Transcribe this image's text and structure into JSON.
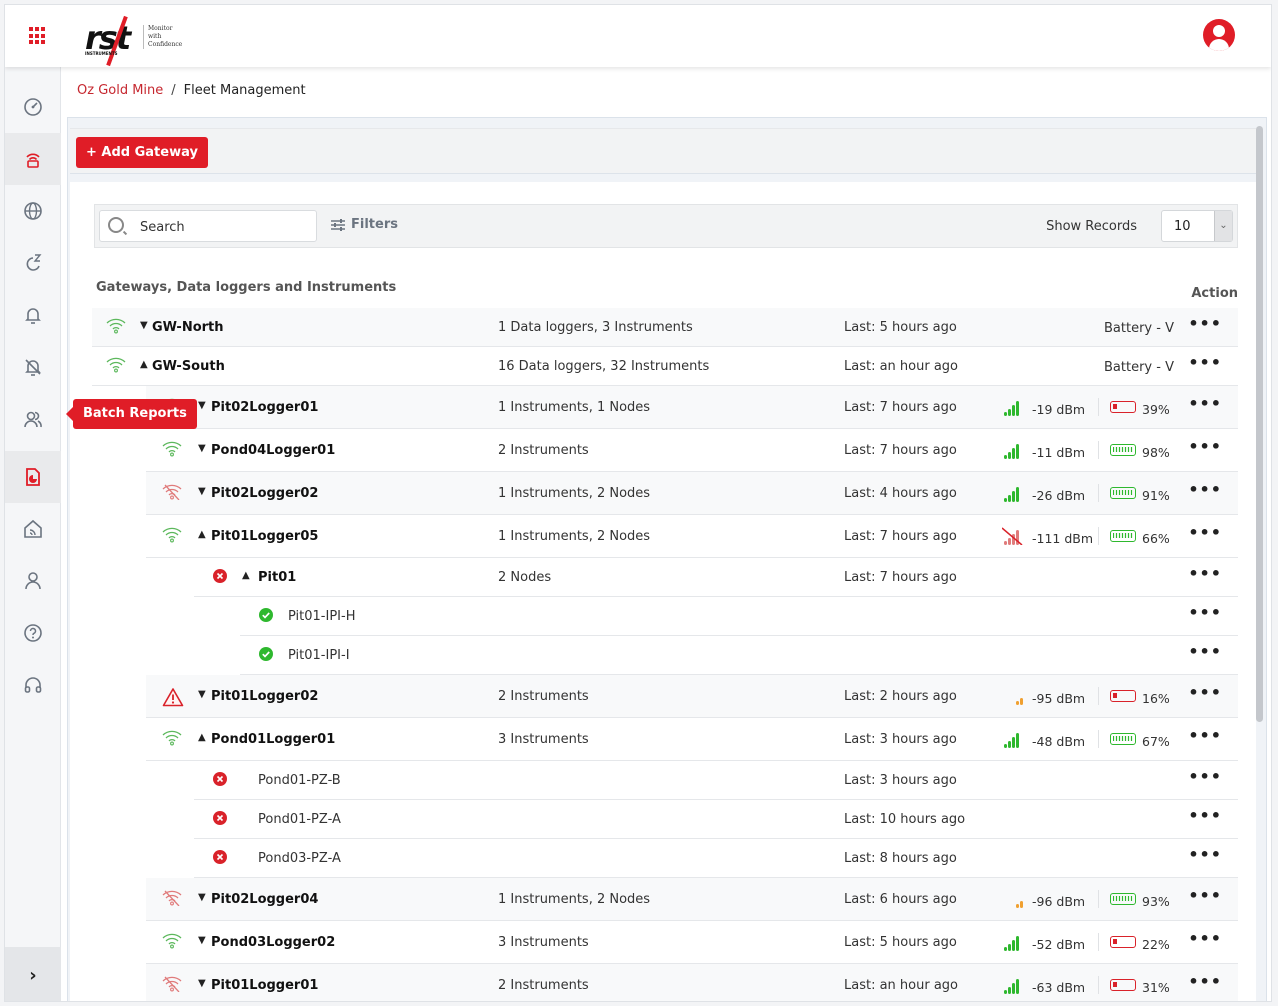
{
  "header": {
    "logo_text": "rst",
    "logo_subtext": "INSTRUMENTS",
    "logo_tagline": "Monitor with Confidence",
    "apps_icon": "grid-apps-icon",
    "user_icon": "user-avatar-icon"
  },
  "sidebar": {
    "items": [
      {
        "icon": "dashboard-gauge-icon",
        "label": "Dashboard",
        "active": false
      },
      {
        "icon": "gateway-router-icon",
        "label": "Fleet Management",
        "active": true
      },
      {
        "icon": "globe-icon",
        "label": "Map",
        "active": false
      },
      {
        "icon": "sleep-icon",
        "label": "Sleep",
        "active": false
      },
      {
        "icon": "bell-icon",
        "label": "Alarms",
        "active": false
      },
      {
        "icon": "bell-off-icon",
        "label": "Muted Alarms",
        "active": false
      },
      {
        "icon": "users-icon",
        "label": "Users",
        "active": false
      },
      {
        "icon": "report-icon",
        "label": "Batch Reports",
        "active": true
      },
      {
        "icon": "home-signal-icon",
        "label": "Sites",
        "active": false
      },
      {
        "icon": "user-icon",
        "label": "Profile",
        "active": false
      },
      {
        "icon": "help-icon",
        "label": "Help",
        "active": false
      },
      {
        "icon": "headset-icon",
        "label": "Support",
        "active": false
      }
    ],
    "tooltip": "Batch Reports",
    "expand_icon": "chevron-right-icon"
  },
  "breadcrumb": {
    "parent": "Oz Gold Mine",
    "separator": "/",
    "current": "Fleet Management"
  },
  "toolbar": {
    "add_gateway_label": "+ Add Gateway"
  },
  "search": {
    "placeholder": "Search",
    "value": "",
    "filters_label": "Filters",
    "show_records_label": "Show Records",
    "records_value": "10"
  },
  "table": {
    "title": "Gateways, Data loggers and Instruments",
    "action_header": "Action",
    "rows": [
      {
        "level": 0,
        "status": "wifi-ok",
        "expand": "down",
        "name": "GW-North",
        "summary": "1 Data loggers, 3 Instruments",
        "last": "Last: 5 hours ago",
        "battery_text": "Battery - V"
      },
      {
        "level": 0,
        "status": "wifi-ok",
        "expand": "up",
        "name": "GW-South",
        "summary": "16 Data loggers, 32 Instruments",
        "last": "Last: an hour ago",
        "battery_text": "Battery - V"
      },
      {
        "level": 1,
        "status": "wifi-ok",
        "expand": "down",
        "name": "Pit02Logger01",
        "summary": "1 Instruments, 1 Nodes",
        "last": "Last: 7 hours ago",
        "signal": "-19 dBm",
        "signal_level": "full",
        "battery_pct": "39%",
        "battery_state": "low"
      },
      {
        "level": 1,
        "status": "wifi-ok",
        "expand": "down",
        "name": "Pond04Logger01",
        "summary": "2 Instruments",
        "last": "Last: 7 hours ago",
        "signal": "-11 dBm",
        "signal_level": "full",
        "battery_pct": "98%",
        "battery_state": "good"
      },
      {
        "level": 1,
        "status": "wifi-off",
        "expand": "down",
        "name": "Pit02Logger02",
        "summary": "1 Instruments, 2 Nodes",
        "last": "Last: 4 hours ago",
        "signal": "-26 dBm",
        "signal_level": "full",
        "battery_pct": "91%",
        "battery_state": "good"
      },
      {
        "level": 1,
        "status": "wifi-ok",
        "expand": "up",
        "name": "Pit01Logger05",
        "summary": "1 Instruments, 2 Nodes",
        "last": "Last: 7 hours ago",
        "signal": "-111 dBm",
        "signal_level": "none",
        "battery_pct": "66%",
        "battery_state": "good"
      },
      {
        "level": 2,
        "status": "error",
        "expand": "up",
        "name": "Pit01",
        "summary": "2 Nodes",
        "last": "Last: 7 hours ago"
      },
      {
        "level": 3,
        "status": "ok",
        "name": "Pit01-IPI-H"
      },
      {
        "level": 3,
        "status": "ok",
        "name": "Pit01-IPI-I"
      },
      {
        "level": 1,
        "status": "warning",
        "expand": "down",
        "name": "Pit01Logger02",
        "summary": "2 Instruments",
        "last": "Last: 2 hours ago",
        "signal": "-95 dBm",
        "signal_level": "weak",
        "battery_pct": "16%",
        "battery_state": "low"
      },
      {
        "level": 1,
        "status": "wifi-ok",
        "expand": "up",
        "name": "Pond01Logger01",
        "summary": "3 Instruments",
        "last": "Last: 3 hours ago",
        "signal": "-48 dBm",
        "signal_level": "full",
        "battery_pct": "67%",
        "battery_state": "good"
      },
      {
        "level": 2,
        "status": "error",
        "name": "Pond01-PZ-B",
        "last": "Last: 3 hours ago"
      },
      {
        "level": 2,
        "status": "error",
        "name": "Pond01-PZ-A",
        "last": "Last: 10 hours ago"
      },
      {
        "level": 2,
        "status": "error",
        "name": "Pond03-PZ-A",
        "last": "Last: 8 hours ago"
      },
      {
        "level": 1,
        "status": "wifi-off",
        "expand": "down",
        "name": "Pit02Logger04",
        "summary": "1 Instruments, 2 Nodes",
        "last": "Last: 6 hours ago",
        "signal": "-96 dBm",
        "signal_level": "weak",
        "battery_pct": "93%",
        "battery_state": "good"
      },
      {
        "level": 1,
        "status": "wifi-ok",
        "expand": "down",
        "name": "Pond03Logger02",
        "summary": "3 Instruments",
        "last": "Last: 5 hours ago",
        "signal": "-52 dBm",
        "signal_level": "full",
        "battery_pct": "22%",
        "battery_state": "low"
      },
      {
        "level": 1,
        "status": "wifi-off",
        "expand": "down",
        "name": "Pit01Logger01",
        "summary": "2 Instruments",
        "last": "Last: an hour ago",
        "signal": "-63 dBm",
        "signal_level": "full",
        "battery_pct": "31%",
        "battery_state": "low"
      }
    ],
    "action_icon": "more-dots-icon"
  },
  "colors": {
    "brand_red": "#e01d27",
    "ok_green": "#2eb82e",
    "wifi_green": "#5cb85c",
    "error_red": "#d9222a",
    "warn_orange": "#f0a030",
    "offline_red": "#e07b7b",
    "sidebar_icon_gray": "#6b7480"
  }
}
